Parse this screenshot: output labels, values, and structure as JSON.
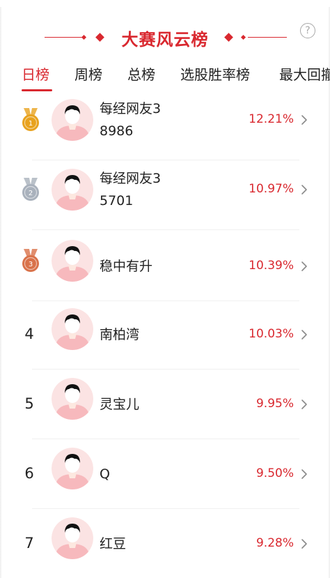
{
  "header": {
    "title": "大赛风云榜",
    "help_glyph": "?"
  },
  "tabs": [
    {
      "label": "日榜",
      "active": true
    },
    {
      "label": "周榜",
      "active": false
    },
    {
      "label": "总榜",
      "active": false
    },
    {
      "label": "选股胜率榜",
      "active": false
    },
    {
      "label": "最大回撤",
      "active": false
    }
  ],
  "ranking": [
    {
      "rank": "1",
      "medal": "gold-medal-icon",
      "name": "每经网友38986",
      "percent": "12.21%"
    },
    {
      "rank": "2",
      "medal": "silver-medal-icon",
      "name": "每经网友35701",
      "percent": "10.97%"
    },
    {
      "rank": "3",
      "medal": "bronze-medal-icon",
      "name": "稳中有升",
      "percent": "10.39%"
    },
    {
      "rank": "4",
      "medal": null,
      "name": "南柏湾",
      "percent": "10.03%"
    },
    {
      "rank": "5",
      "medal": null,
      "name": "灵宝儿",
      "percent": "9.95%"
    },
    {
      "rank": "6",
      "medal": null,
      "name": "Q",
      "percent": "9.50%"
    },
    {
      "rank": "7",
      "medal": null,
      "name": "红豆",
      "percent": "9.28%"
    }
  ],
  "colors": {
    "accent": "#d9282f",
    "gold": "#e8a21e",
    "silver": "#a9b1bc",
    "bronze": "#d9724a",
    "avatar_bg": "#fbe3e3"
  }
}
